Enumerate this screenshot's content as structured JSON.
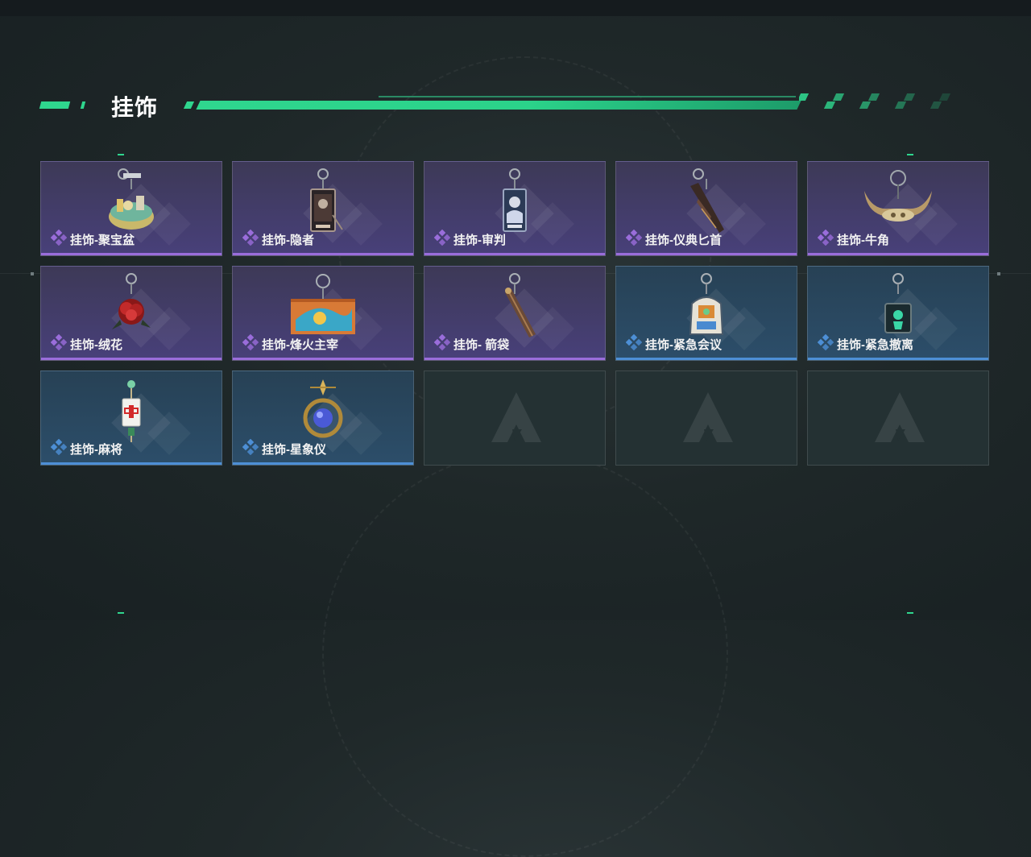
{
  "header": {
    "title": "挂饰"
  },
  "colors": {
    "accent": "#2fd68e",
    "purple_rarity": "#9a6ddb",
    "blue_rarity": "#4d8fd6"
  },
  "items": [
    {
      "label": "挂饰-聚宝盆",
      "rarity": "purple",
      "icon": "treasure-bowl-icon"
    },
    {
      "label": "挂饰-隐者",
      "rarity": "purple",
      "icon": "hermit-card-icon"
    },
    {
      "label": "挂饰-审判",
      "rarity": "purple",
      "icon": "judgement-card-icon"
    },
    {
      "label": "挂饰-仪典匕首",
      "rarity": "purple",
      "icon": "dagger-icon"
    },
    {
      "label": "挂饰-牛角",
      "rarity": "purple",
      "icon": "horns-icon"
    },
    {
      "label": "挂饰-绒花",
      "rarity": "purple",
      "icon": "velvet-flower-icon"
    },
    {
      "label": "挂饰-烽火主宰",
      "rarity": "purple",
      "icon": "beacon-banner-icon"
    },
    {
      "label": "挂饰- 箭袋",
      "rarity": "purple",
      "icon": "quiver-icon"
    },
    {
      "label": "挂饰-紧急会议",
      "rarity": "blue",
      "icon": "emergency-meeting-icon"
    },
    {
      "label": "挂饰-紧急撤离",
      "rarity": "blue",
      "icon": "emergency-evacuation-icon"
    },
    {
      "label": "挂饰-麻将",
      "rarity": "blue",
      "icon": "mahjong-tile-icon"
    },
    {
      "label": "挂饰-星象仪",
      "rarity": "blue",
      "icon": "astrolabe-icon"
    },
    {
      "label": "",
      "rarity": "empty",
      "icon": "empty-slot-logo-icon"
    },
    {
      "label": "",
      "rarity": "empty",
      "icon": "empty-slot-logo-icon"
    },
    {
      "label": "",
      "rarity": "empty",
      "icon": "empty-slot-logo-icon"
    }
  ]
}
